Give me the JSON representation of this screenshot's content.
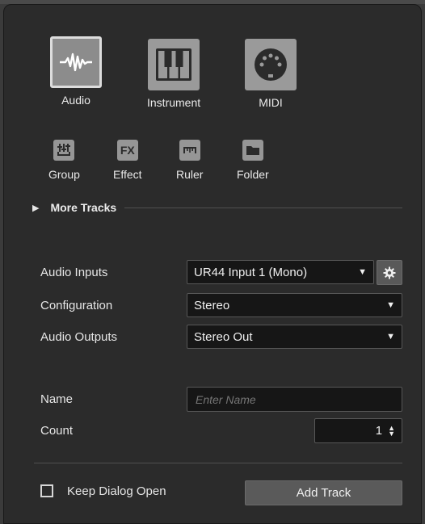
{
  "track_types_main": [
    {
      "label": "Audio",
      "icon": "audio-waveform-icon",
      "selected": true
    },
    {
      "label": "Instrument",
      "icon": "piano-keys-icon",
      "selected": false
    },
    {
      "label": "MIDI",
      "icon": "midi-port-icon",
      "selected": false
    }
  ],
  "track_types_secondary": [
    {
      "label": "Group",
      "icon": "group-fader-icon",
      "glyph": ""
    },
    {
      "label": "Effect",
      "icon": "fx-icon",
      "glyph": "FX"
    },
    {
      "label": "Ruler",
      "icon": "ruler-icon",
      "glyph": ""
    },
    {
      "label": "Folder",
      "icon": "folder-icon",
      "glyph": ""
    }
  ],
  "more_tracks": {
    "label": "More Tracks",
    "icon": "triangle-right-icon"
  },
  "fields": {
    "audio_inputs": {
      "label": "Audio Inputs",
      "value": "UR44 Input 1 (Mono)"
    },
    "configuration": {
      "label": "Configuration",
      "value": "Stereo"
    },
    "audio_outputs": {
      "label": "Audio Outputs",
      "value": "Stereo Out"
    },
    "name": {
      "label": "Name",
      "placeholder": "Enter Name",
      "value": ""
    },
    "count": {
      "label": "Count",
      "value": "1"
    }
  },
  "keep_dialog_open": {
    "label": "Keep Dialog Open",
    "checked": false
  },
  "add_track": {
    "label": "Add Track"
  },
  "colors": {
    "panel": "#2b2b2b",
    "field": "#161616",
    "button": "#5a5a5a",
    "icon_tile": "#9a9a9a"
  }
}
